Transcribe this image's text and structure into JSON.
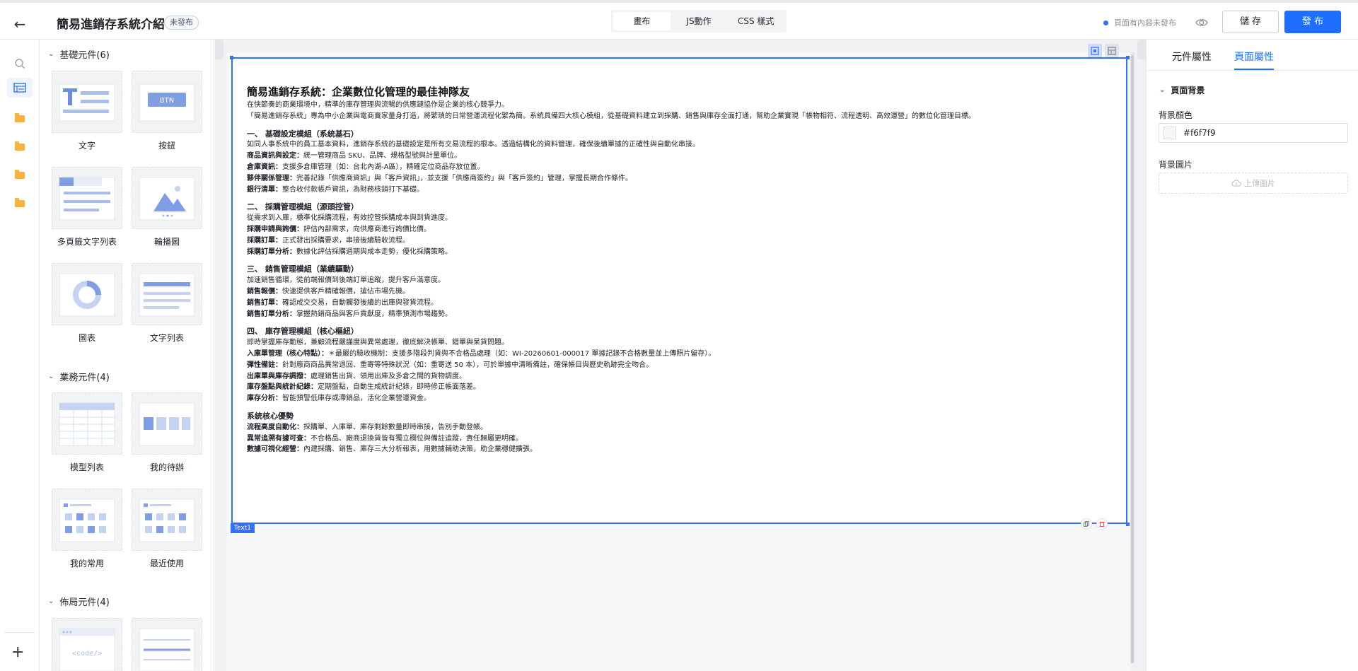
{
  "header": {
    "title": "簡易進銷存系統介紹",
    "status": "未發布",
    "tabs": [
      "畫布",
      "JS動作",
      "CSS 樣式"
    ],
    "save_state": "頁面有內容未發布",
    "save_label": "儲 存",
    "publish_label": "發 布"
  },
  "colors": {
    "accent": "#1f6fff",
    "selection": "#3370ff",
    "folder": "#f6b23d"
  },
  "panel": {
    "sections": [
      {
        "title": "基礎元件(6)",
        "items": [
          "文字",
          "按鈕",
          "多頁籤文字列表",
          "輪播圖",
          "圖表",
          "文字列表"
        ]
      },
      {
        "title": "業務元件(4)",
        "items": [
          "模型列表",
          "我的待辦",
          "我的常用",
          "最近使用"
        ]
      },
      {
        "title": "佈局元件(4)",
        "items": []
      }
    ],
    "btn_text": "BTN",
    "code_text": "<code/>"
  },
  "canvas": {
    "block_tag": "Text1",
    "heading": "簡易進銷存系統：企業數位化管理的最佳神隊友",
    "intro": [
      "在快節奏的商業環境中，精準的庫存管理與流暢的供應鏈協作是企業的核心競爭力。",
      "「簡易進銷存系統」專為中小企業與電商賣家量身打造，將繁瑣的日常營運流程化繁為簡。系統具備四大核心模組，從基礎資料建立到採購、銷售與庫存全面打通，幫助企業實現「帳物相符、流程透明、高效運營」的數位化管理目標。"
    ],
    "sections": [
      {
        "title": "一、 基礎設定模組（系統基石）",
        "lines": [
          {
            "b": "",
            "t": "如同人事系統中的員工基本資料，進銷存系統的基礎設定是所有交易流程的根本。透過結構化的資料管理，確保後續單據的正確性與自動化串接。"
          },
          {
            "b": "商品資訊與設定：",
            "t": "統一管理商品 SKU、品牌、規格型號與計量單位。"
          },
          {
            "b": "倉庫資訊：",
            "t": "支援多倉庫管理（如：台北內湖-A區），精確定位商品存放位置。"
          },
          {
            "b": "夥伴關係管理：",
            "t": "完善記錄「供應商資訊」與「客戶資訊」，並支援「供應商簽約」與「客戶簽約」管理，掌握長期合作條件。"
          },
          {
            "b": "銀行清單：",
            "t": "整合收付款帳戶資訊，為財務核銷打下基礎。"
          }
        ]
      },
      {
        "title": "二、 採購管理模組（源頭控管）",
        "lines": [
          {
            "b": "",
            "t": "從需求到入庫，標準化採購流程，有效控管採購成本與到貨進度。"
          },
          {
            "b": "採購申請與詢價：",
            "t": "評估內部需求，向供應商進行詢價比價。"
          },
          {
            "b": "採購訂單：",
            "t": "正式發出採購要求，串接後續驗收流程。"
          },
          {
            "b": "採購訂單分析：",
            "t": "數據化評估採購週期與成本走勢，優化採購策略。"
          }
        ]
      },
      {
        "title": "三、 銷售管理模組（業績驅動）",
        "lines": [
          {
            "b": "",
            "t": "加速銷售循環，從前端報價到後端訂單追蹤，提升客戶滿意度。"
          },
          {
            "b": "銷售報價：",
            "t": "快速提供客戶精確報價，搶佔市場先機。"
          },
          {
            "b": "銷售訂單：",
            "t": "確認成交交易，自動觸發後續的出庫與發貨流程。"
          },
          {
            "b": "銷售訂單分析：",
            "t": "掌握熱銷商品與客戶貢獻度，精準預測市場趨勢。"
          }
        ]
      },
      {
        "title": "四、 庫存管理模組（核心樞紐）",
        "lines": [
          {
            "b": "",
            "t": "即時掌握庫存動態，兼顧流程嚴謹度與異常處理，徹底解決帳單、錯單與呆貨問題。"
          },
          {
            "b": "入庫單管理（核心特點）：",
            "t": "＊最嚴的驗收機制：支援多階段判貨與不合格品處理（如：WI-20260601-000017 單據記錄不合格數量並上傳照片留存）。"
          },
          {
            "b": "彈性備註：",
            "t": "針對廠商商品異常退回、重寄等特殊狀況（如：重寄送 50 本），可於單據中清晰備註，確保帳目與歷史軌跡完全吻合。"
          },
          {
            "b": "出庫單與庫存調撥：",
            "t": "處理銷售出貨、領用出庫及多倉之間的貨物調度。"
          },
          {
            "b": "庫存盤點與統計紀錄：",
            "t": "定期盤點，自動生成統計紀錄，即時修正帳面落差。"
          },
          {
            "b": "庫存分析：",
            "t": "智能預警低庫存或滯銷品，活化企業營運資金。"
          }
        ]
      },
      {
        "title": "系統核心優勢",
        "lines": [
          {
            "b": "流程高度自動化：",
            "t": "採購單、入庫單、庫存剩餘數量即時串接，告別手動登帳。"
          },
          {
            "b": "異常追溯有據可查：",
            "t": "不合格品、廠商退換貨皆有獨立欄位與備註追蹤，責任歸屬更明確。"
          },
          {
            "b": "數據可視化經營：",
            "t": "內建採購、銷售、庫存三大分析報表，用數據輔助決策，助企業穩健擴張。"
          }
        ]
      }
    ]
  },
  "props": {
    "tabs": [
      "元件屬性",
      "頁面屬性"
    ],
    "section": "頁面背景",
    "bg_color_label": "背景顏色",
    "bg_color_value": "#f6f7f9",
    "bg_image_label": "背景圖片",
    "upload_label": "上傳圖片"
  }
}
